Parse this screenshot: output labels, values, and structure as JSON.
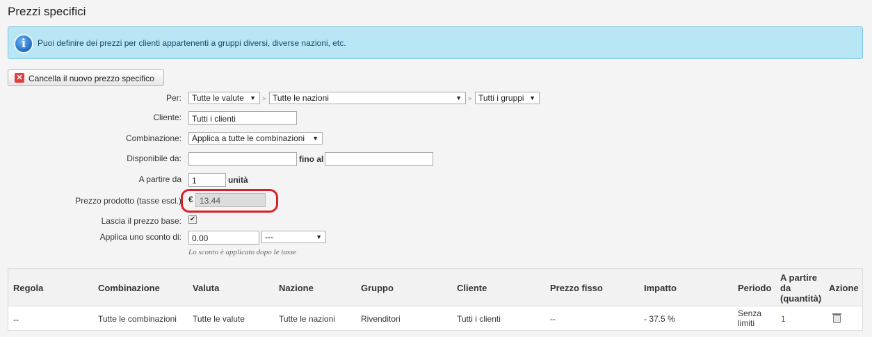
{
  "page": {
    "title": "Prezzi specifici"
  },
  "info": {
    "text": "Puoi definire dei prezzi per clienti appartenenti a gruppi diversi, diverse nazioni, etc."
  },
  "cancel_button": {
    "label": "Cancella il nuovo prezzo specifico"
  },
  "form": {
    "per": {
      "label": "Per:",
      "currency": "Tutte le valute",
      "country": "Tutte le nazioni",
      "group": "Tutti i gruppi",
      "separator": ">"
    },
    "cliente": {
      "label": "Cliente:",
      "value": "Tutti i clienti"
    },
    "combinazione": {
      "label": "Combinazione:",
      "value": "Applica a tutte le combinazioni"
    },
    "disponibile": {
      "label": "Disponibile da:",
      "from": "",
      "to_label": "fino al",
      "to": ""
    },
    "a_partire": {
      "label": "A partire da",
      "value": "1",
      "unit": "unità"
    },
    "prezzo": {
      "label": "Prezzo prodotto (tasse escl.)",
      "currency_symbol": "€",
      "value": "13.44"
    },
    "lascia": {
      "label": "Lascia il prezzo base:",
      "checked": true
    },
    "sconto": {
      "label": "Applica uno sconto di:",
      "value": "0.00",
      "type": "---",
      "note": "Lo sconto è applicato dopo le tasse"
    }
  },
  "table": {
    "headers": {
      "regola": "Regola",
      "combinazione": "Combinazione",
      "valuta": "Valuta",
      "nazione": "Nazione",
      "gruppo": "Gruppo",
      "cliente": "Cliente",
      "prezzo_fisso": "Prezzo fisso",
      "impatto": "Impatto",
      "periodo": "Periodo",
      "a_partire_1": "A partire",
      "a_partire_2": "da",
      "a_partire_3": "(quantità)",
      "azione": "Azione"
    },
    "rows": [
      {
        "regola": "--",
        "combinazione": "Tutte le combinazioni",
        "valuta": "Tutte le valute",
        "nazione": "Tutte le nazioni",
        "gruppo": "Rivenditori",
        "cliente": "Tutti i clienti",
        "prezzo_fisso": "--",
        "impatto": "- 37.5 %",
        "periodo_1": "Senza",
        "periodo_2": "limiti",
        "quantita": "1"
      }
    ]
  },
  "icons": {
    "info": "info-icon",
    "cancel": "cancel-x-icon",
    "delete": "trash-icon",
    "check": "checkmark-icon"
  }
}
